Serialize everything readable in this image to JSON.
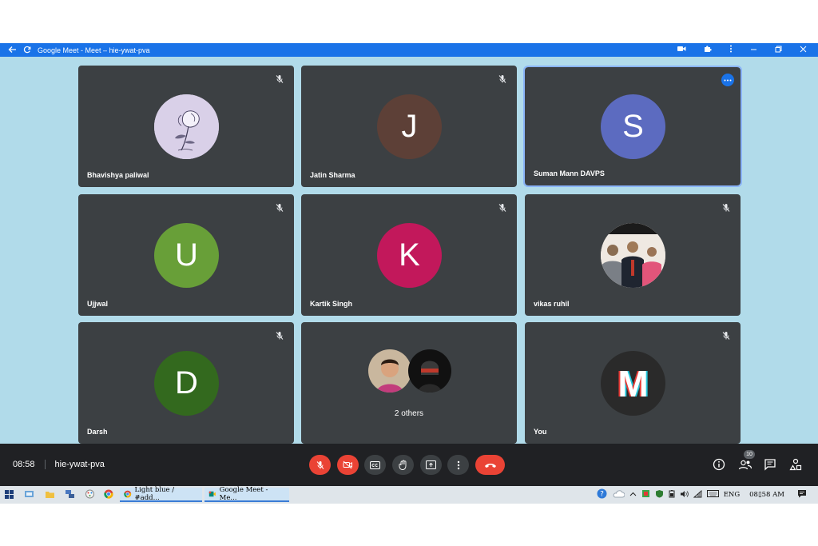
{
  "window": {
    "title": "Google Meet - Meet – hie-ywat-pva"
  },
  "tiles": [
    {
      "name": "Bhavishya paliwal",
      "initial": "",
      "color": "#d7cde6"
    },
    {
      "name": "Jatin Sharma",
      "initial": "J",
      "color": "#5d4037"
    },
    {
      "name": "Suman Mann DAVPS",
      "initial": "S",
      "color": "#5c6bc0"
    },
    {
      "name": "Ujjwal",
      "initial": "U",
      "color": "#689f38"
    },
    {
      "name": "Kartik Singh",
      "initial": "K",
      "color": "#c2185b"
    },
    {
      "name": "vikas ruhil",
      "initial": "",
      "color": "#e9e4de"
    },
    {
      "name": "Darsh",
      "initial": "D",
      "color": "#33691e"
    },
    {
      "name": "2 others",
      "initial": "",
      "color": ""
    },
    {
      "name": "You",
      "initial": "M",
      "color": "#2a2a2a"
    }
  ],
  "controls": {
    "time": "08:58",
    "meeting_code": "hie-ywat-pva",
    "participants_count": "10"
  },
  "taskbar": {
    "task1": "Light blue / #add...",
    "task2": "Google Meet - Me...",
    "lang": "ENG",
    "clock": "08▯58 AM"
  },
  "colors": {
    "accent": "#1a73e8",
    "meet_bg": "#b1dbea",
    "tile_bg": "#3c4043",
    "danger": "#ea4335"
  }
}
